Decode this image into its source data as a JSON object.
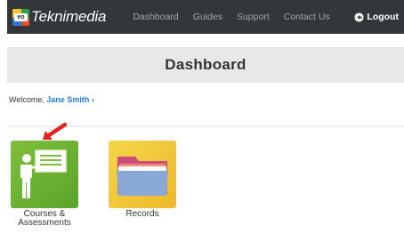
{
  "brand": {
    "name": "Teknimedia",
    "logo_tag": "eo"
  },
  "nav": {
    "items": [
      {
        "label": "Dashboard"
      },
      {
        "label": "Guides"
      },
      {
        "label": "Support"
      },
      {
        "label": "Contact Us"
      }
    ],
    "logout_label": "Logout"
  },
  "page": {
    "title": "Dashboard"
  },
  "welcome": {
    "prefix": "Welcome, ",
    "user_name": "Jane Smith",
    "chevron": "›"
  },
  "tiles": [
    {
      "line1": "Courses &",
      "line2": "Assessments",
      "icon": "instructor-board-icon"
    },
    {
      "line1": "Records",
      "line2": "",
      "icon": "folder-icon"
    }
  ],
  "colors": {
    "topbar": "#33363b",
    "nav_text": "#a3a7ad",
    "link": "#2a7ccf",
    "courses_tile": "#6cb232",
    "records_tile": "#f1c636",
    "arrow": "#e32222"
  }
}
